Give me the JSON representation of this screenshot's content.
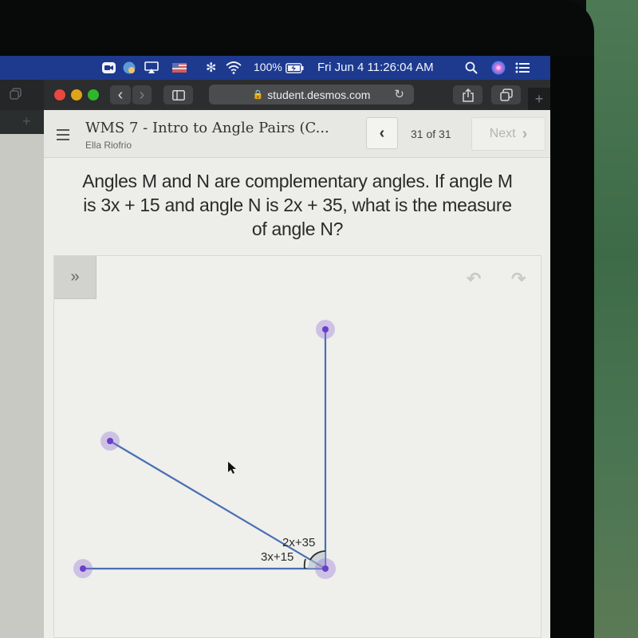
{
  "menubar": {
    "battery": "100%",
    "datetime": "Fri Jun 4  11:26:04 AM",
    "icons": [
      "zoom-icon",
      "globe-icon",
      "airplay-icon",
      "flag-icon",
      "bluetooth-icon",
      "wifi-icon",
      "battery-charging-icon",
      "spotlight-search-icon",
      "siri-icon",
      "notification-center-icon"
    ]
  },
  "browser": {
    "url": "student.desmos.com",
    "back_glyph": "‹",
    "forward_glyph": "›",
    "newtab_glyph": "+",
    "colors": {
      "close": "#e8483f",
      "minimize": "#e0a418",
      "maximize": "#2fb62a"
    }
  },
  "activity": {
    "title": "WMS 7 - Intro to Angle Pairs (C...",
    "student": "Ella Riofrio",
    "prev_glyph": "‹",
    "page_count": "31 of 31",
    "next_label": "Next",
    "next_glyph": "›"
  },
  "question": {
    "line1": "Angles M and N are complementary angles. If angle M",
    "line2": "is 3x + 15 and angle N is 2x + 35, what is the measure",
    "line3": "of angle N?"
  },
  "sketch": {
    "expand_glyph": "»",
    "undo_glyph": "↶",
    "redo_glyph": "↷",
    "angle_label_n": "2x+35",
    "angle_label_m": "3x+15",
    "line_color": "#4a6fb3",
    "point_color": "#6a3fc9"
  }
}
